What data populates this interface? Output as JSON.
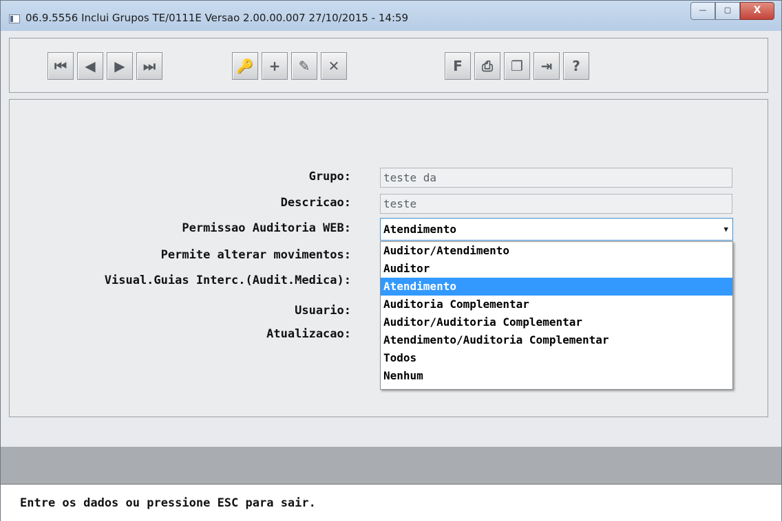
{
  "window": {
    "title": "06.9.5556  Inclui  Grupos TE/0111E Versao 2.00.00.007 27/10/2015 - 14:59",
    "minimize": "—",
    "maximize": "▢",
    "close": "X"
  },
  "toolbar": {
    "buttons": [
      {
        "name": "first-record",
        "icon": "⏮"
      },
      {
        "name": "previous-record",
        "icon": "◀"
      },
      {
        "name": "next-record",
        "icon": "▶"
      },
      {
        "name": "last-record",
        "icon": "⏭"
      },
      {
        "name": "search",
        "icon": "🔑"
      },
      {
        "name": "insert",
        "icon": "+"
      },
      {
        "name": "edit",
        "icon": "✎"
      },
      {
        "name": "delete",
        "icon": "✕"
      },
      {
        "name": "filter",
        "icon": "F"
      },
      {
        "name": "print",
        "icon": "⎙"
      },
      {
        "name": "copy",
        "icon": "❐"
      },
      {
        "name": "exit",
        "icon": "⇥"
      },
      {
        "name": "help",
        "icon": "?"
      }
    ]
  },
  "form": {
    "grupo_label": "Grupo:",
    "grupo_value": "teste da",
    "descricao_label": "Descricao:",
    "descricao_value": "teste",
    "permissao_label": "Permissao Auditoria WEB:",
    "permissao_value": "Atendimento",
    "permite_label": "Permite alterar movimentos:",
    "visual_label": "Visual.Guias Interc.(Audit.Medica):",
    "usuario_label": "Usuario:",
    "atualizacao_label": "Atualizacao:"
  },
  "dropdown": {
    "options": [
      "Auditor/Atendimento",
      "Auditor",
      "Atendimento",
      "Auditoria Complementar",
      "Auditor/Auditoria Complementar",
      "Atendimento/Auditoria Complementar",
      "Todos",
      "Nenhum"
    ],
    "selected_index": 2
  },
  "status": {
    "message": "Entre os dados ou pressione ESC para sair."
  },
  "colors": {
    "selection": "#3399ff",
    "titlebar": "#c9dbee",
    "close_button": "#c2433a"
  }
}
